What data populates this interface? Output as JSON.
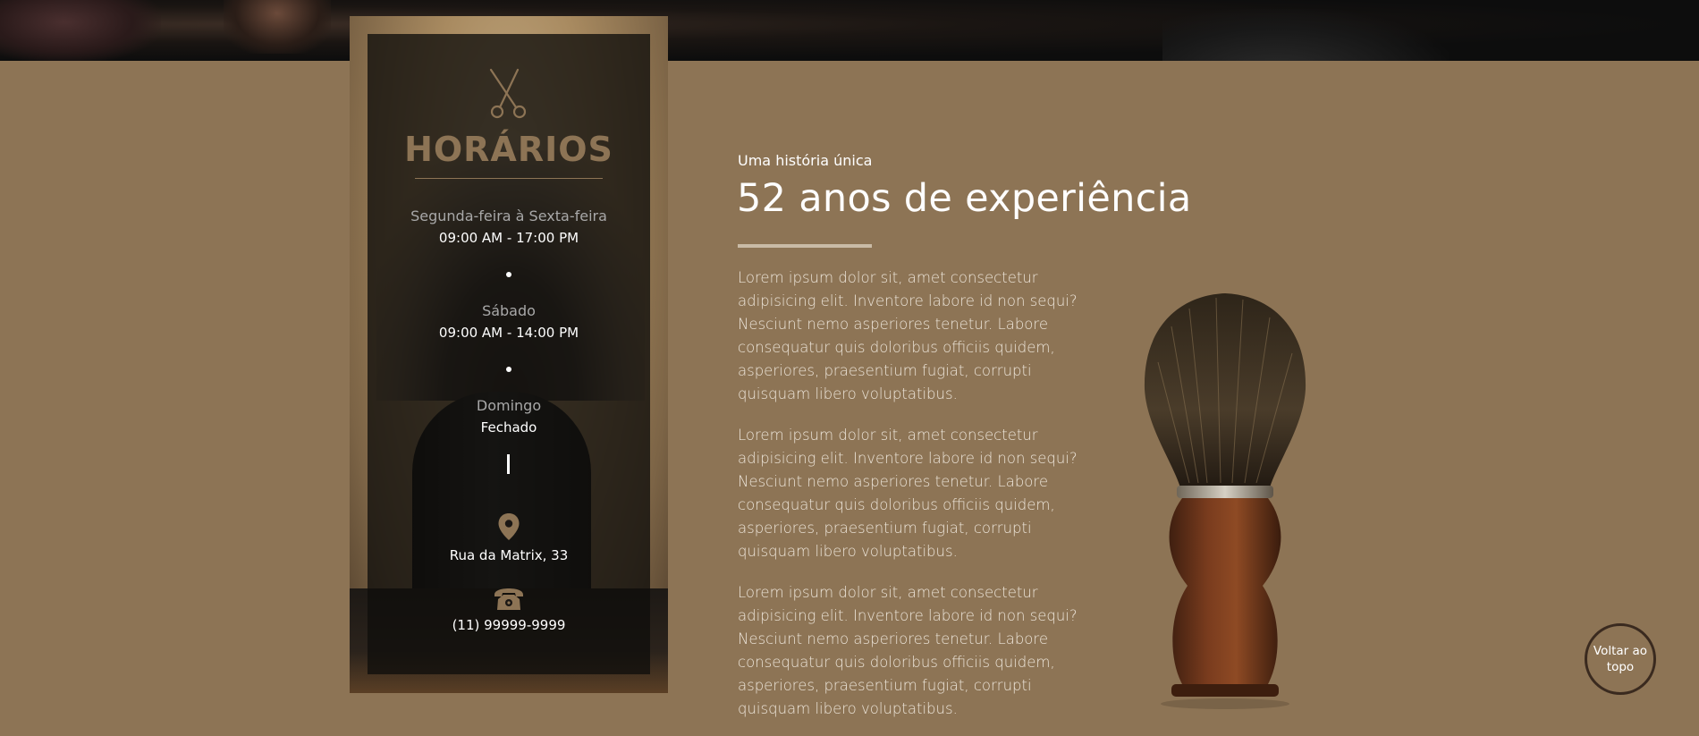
{
  "hours_card": {
    "title": "HORÁRIOS",
    "schedule": [
      {
        "day": "Segunda-feira à Sexta-feira",
        "hours": "09:00 AM - 17:00 PM"
      },
      {
        "day": "Sábado",
        "hours": "09:00 AM - 14:00 PM"
      },
      {
        "day": "Domingo",
        "hours": "Fechado"
      }
    ],
    "address": "Rua da Matrix, 33",
    "phone": "(11) 99999-9999",
    "icons": {
      "header": "scissors-icon",
      "address": "map-pin-icon",
      "phone": "telephone-icon"
    }
  },
  "about": {
    "kicker": "Uma história única",
    "headline": "52 anos de experiência",
    "paragraphs": [
      "Lorem ipsum dolor sit, amet consectetur adipisicing elit. Inventore labore id non sequi? Nesciunt nemo asperiores tenetur. Labore consequatur quis doloribus officiis quidem, asperiores, praesentium fugiat, corrupti quisquam libero voluptatibus.",
      "Lorem ipsum dolor sit, amet consectetur adipisicing elit. Inventore labore id non sequi? Nesciunt nemo asperiores tenetur. Labore consequatur quis doloribus officiis quidem, asperiores, praesentium fugiat, corrupti quisquam libero voluptatibus.",
      "Lorem ipsum dolor sit, amet consectetur adipisicing elit. Inventore labore id non sequi? Nesciunt nemo asperiores tenetur. Labore consequatur quis doloribus officiis quidem, asperiores, praesentium fugiat, corrupti quisquam libero voluptatibus."
    ]
  },
  "back_to_top": {
    "label": "Voltar ao topo"
  },
  "colors": {
    "background": "#8d7455",
    "accent": "#8d7455",
    "card_overlay": "#100e0c",
    "hero": "#0e0e0e"
  }
}
